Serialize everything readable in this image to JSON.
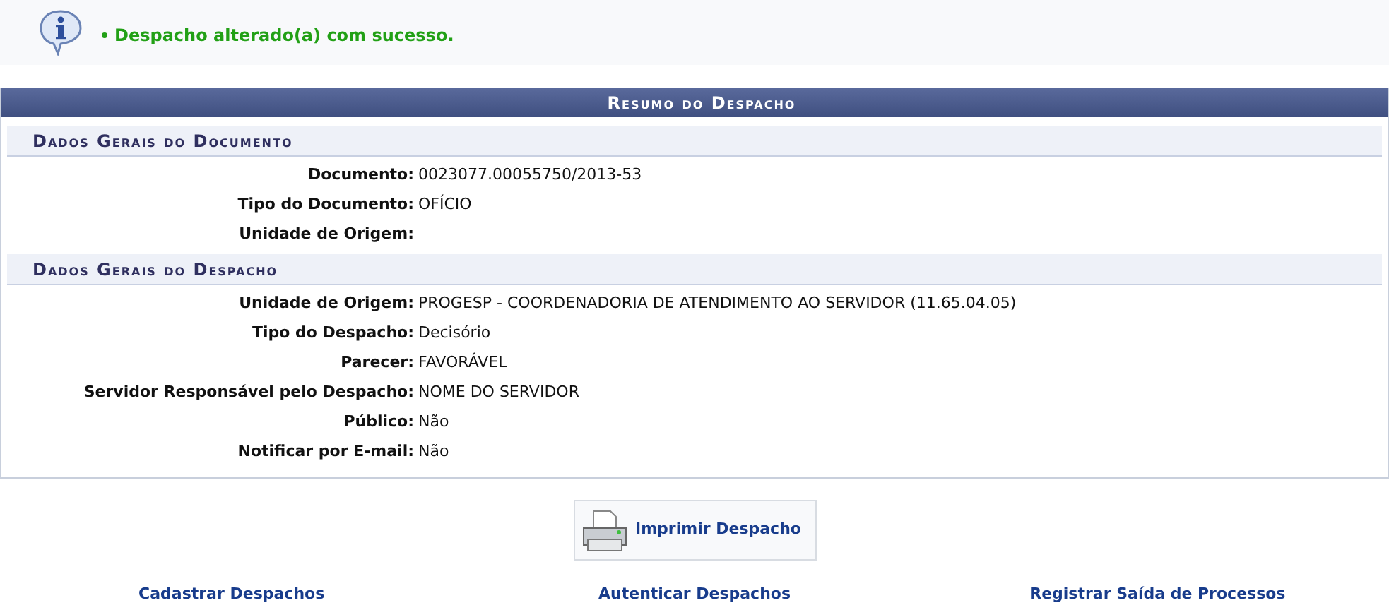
{
  "message": {
    "text": "Despacho alterado(a) com sucesso."
  },
  "summary": {
    "title": "Resumo do Despacho",
    "sections": [
      {
        "title": "Dados Gerais do Documento",
        "fields": [
          {
            "label": "Documento:",
            "value": "0023077.00055750/2013-53"
          },
          {
            "label": "Tipo do Documento:",
            "value": "OFÍCIO"
          },
          {
            "label": "Unidade de Origem:"
          }
        ]
      },
      {
        "title": "Dados Gerais do Despacho",
        "fields": [
          {
            "label": "Unidade de Origem:",
            "value": "PROGESP - COORDENADORIA DE ATENDIMENTO AO SERVIDOR (11.65.04.05)"
          },
          {
            "label": "Tipo do Despacho:",
            "value": "Decisório"
          },
          {
            "label": "Parecer:",
            "value": "FAVORÁVEL"
          },
          {
            "label": "Servidor Responsável pelo Despacho:",
            "value": "NOME DO SERVIDOR"
          },
          {
            "label": "Público:",
            "value": "Não"
          },
          {
            "label": "Notificar por E-mail:",
            "value": "Não"
          }
        ]
      }
    ]
  },
  "print_button": {
    "label": "Imprimir Despacho"
  },
  "links": [
    "Cadastrar Despachos",
    "Autenticar Despachos",
    "Registrar Saída de Processos"
  ]
}
